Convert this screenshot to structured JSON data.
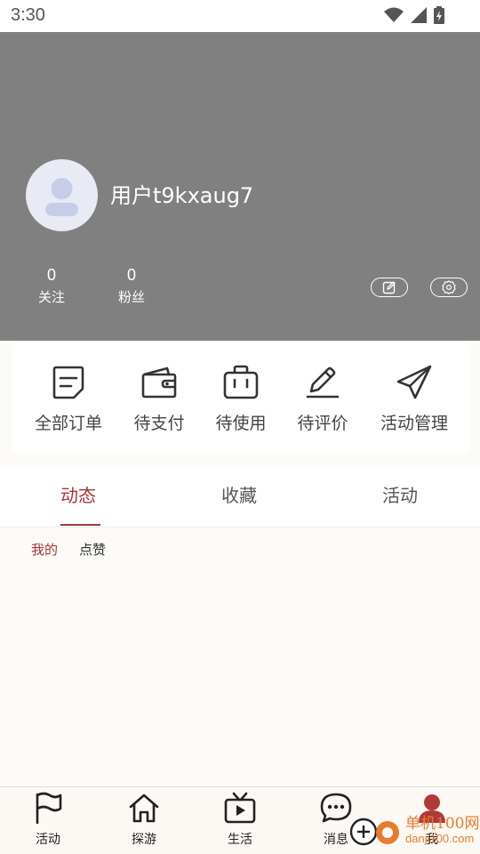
{
  "status_bar": {
    "time": "3:30"
  },
  "profile": {
    "username": "用户t9kxaug7",
    "stats": [
      {
        "value": "0",
        "label": "关注"
      },
      {
        "value": "0",
        "label": "粉丝"
      }
    ]
  },
  "orders": [
    {
      "label": "全部订单",
      "icon": "order-list-icon"
    },
    {
      "label": "待支付",
      "icon": "wallet-icon"
    },
    {
      "label": "待使用",
      "icon": "suitcase-icon"
    },
    {
      "label": "待评价",
      "icon": "pen-icon"
    },
    {
      "label": "活动管理",
      "icon": "paper-plane-icon"
    }
  ],
  "tabs": [
    "动态",
    "收藏",
    "活动"
  ],
  "subtabs": [
    "我的",
    "点赞"
  ],
  "bottom_nav": [
    {
      "label": "活动",
      "icon": "flag-icon"
    },
    {
      "label": "探游",
      "icon": "home-icon"
    },
    {
      "label": "生活",
      "icon": "tv-icon"
    },
    {
      "label": "消息",
      "icon": "chat-icon"
    },
    {
      "label": "我",
      "icon": "user-icon"
    }
  ],
  "watermark": {
    "title": "单机100网",
    "url": "danji100.com"
  },
  "colors": {
    "accent": "#a83535",
    "header_bg": "#808080"
  }
}
